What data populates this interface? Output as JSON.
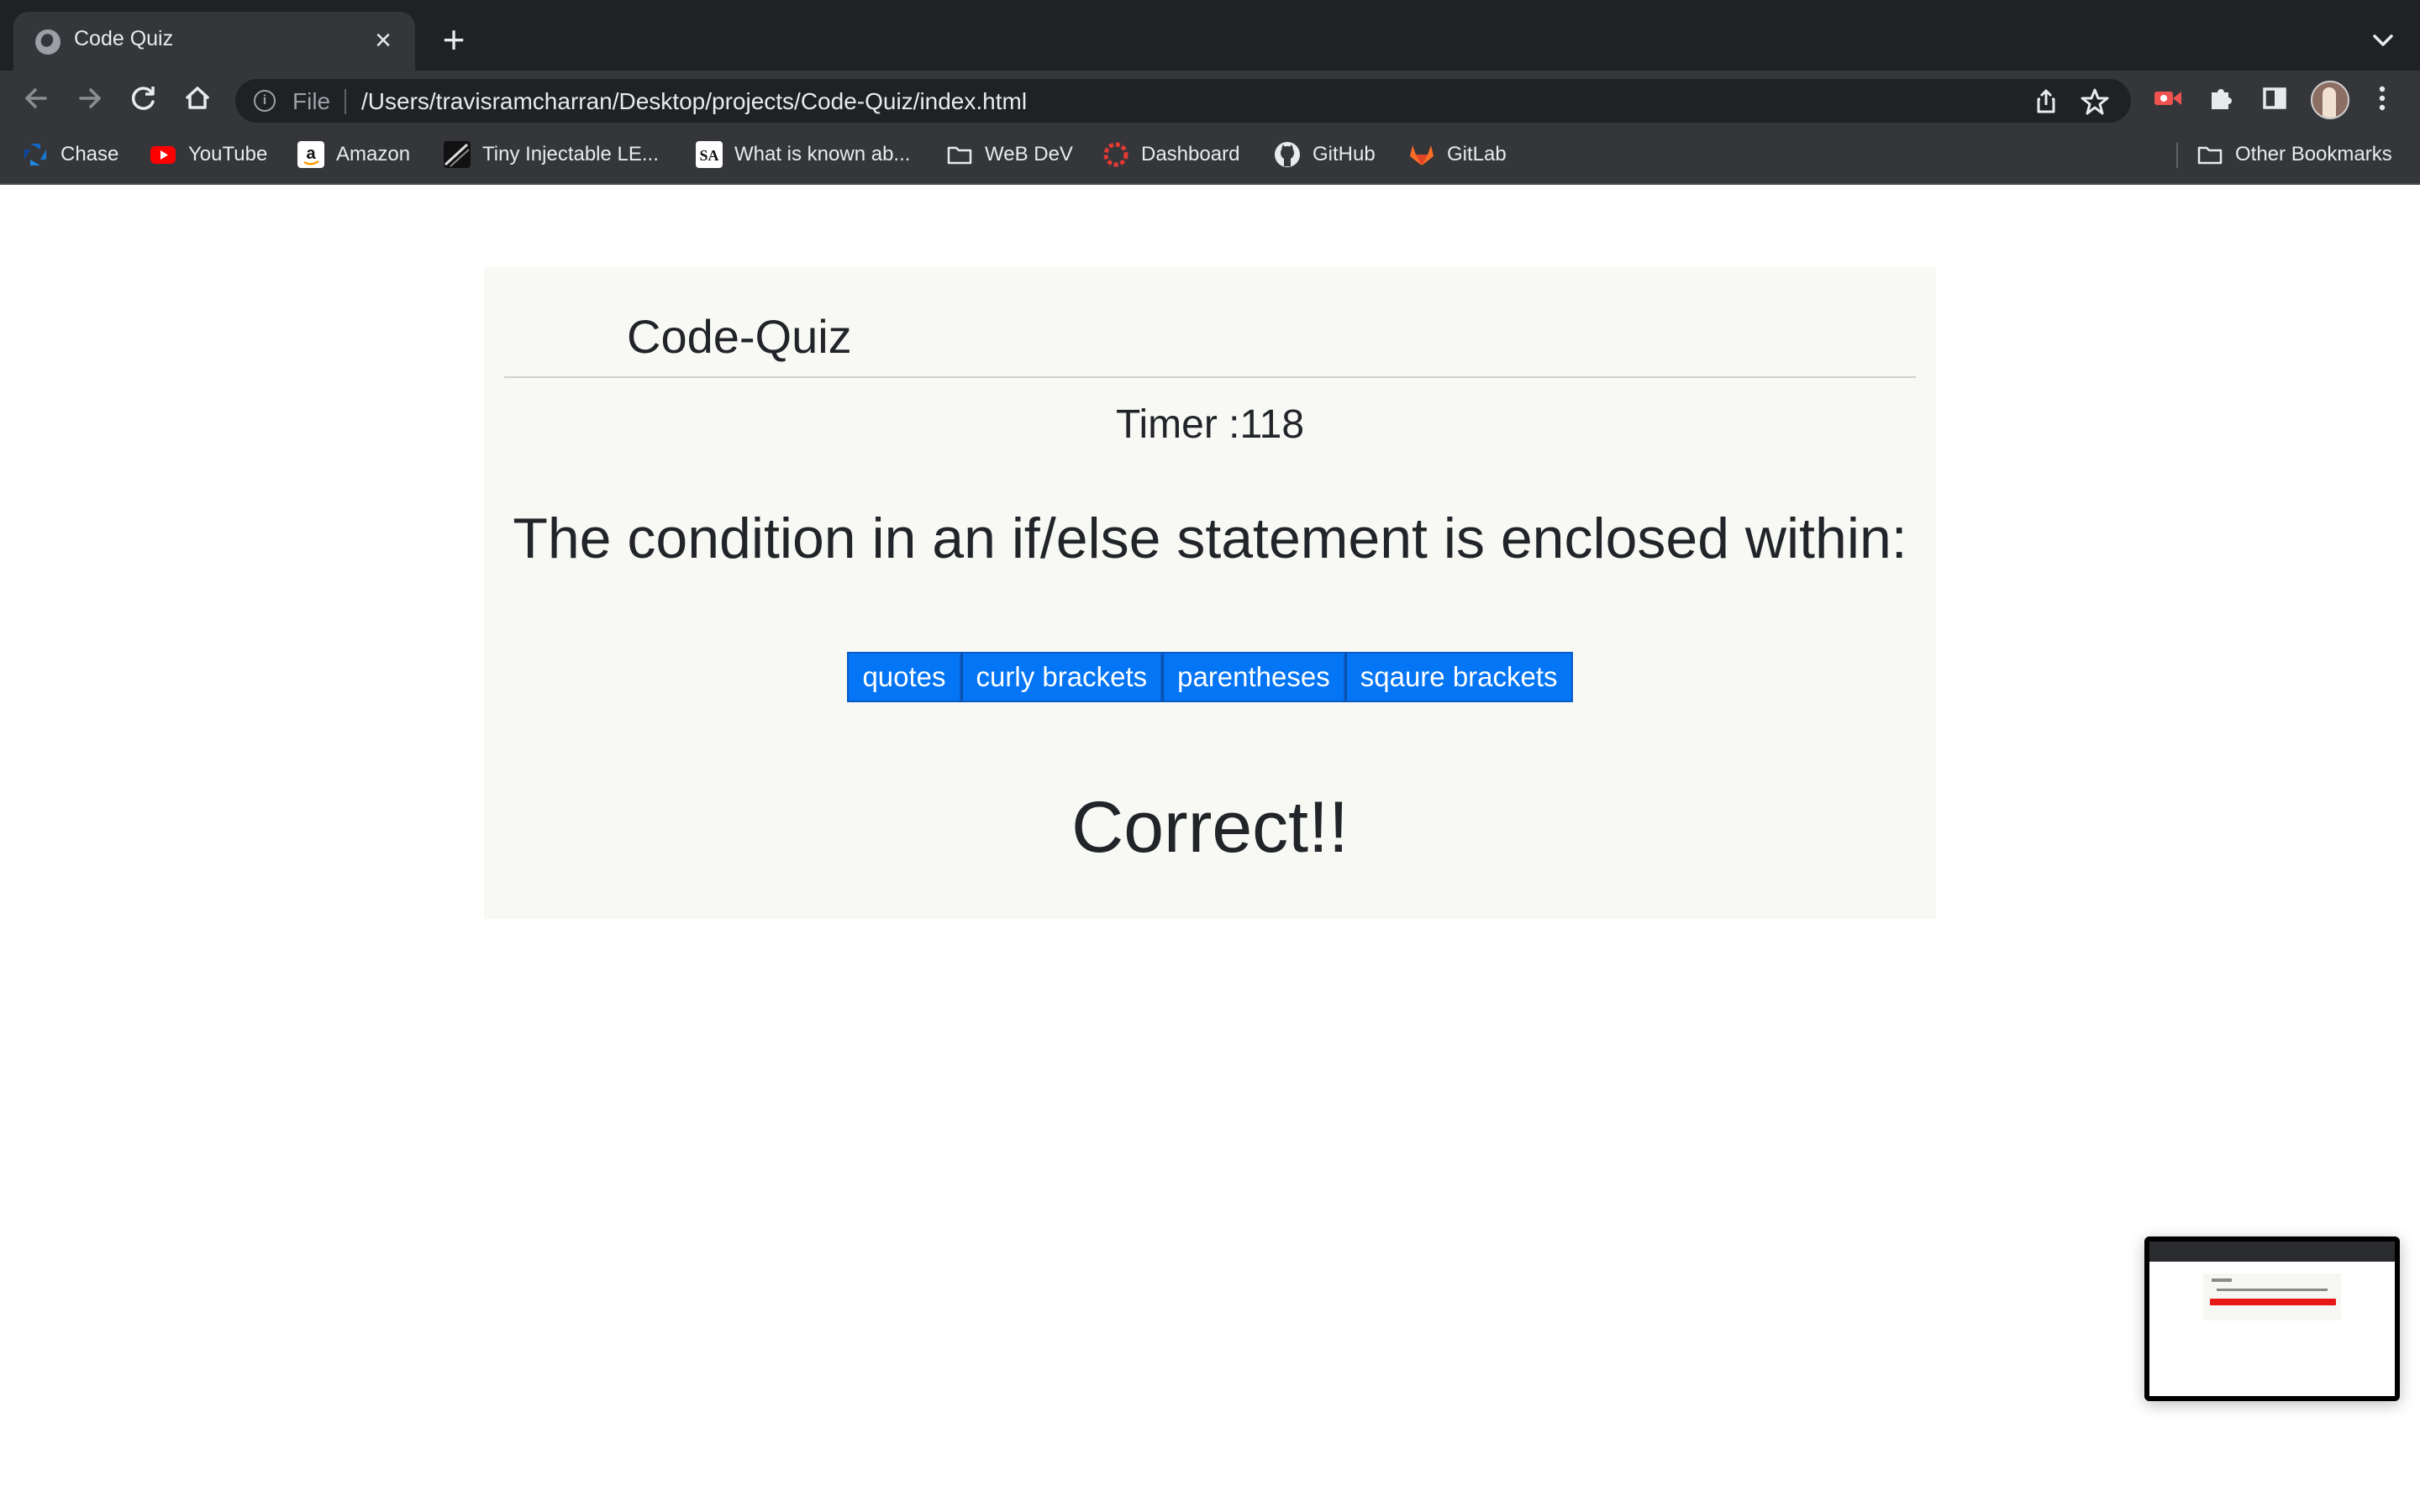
{
  "browser": {
    "tab": {
      "title": "Code Quiz"
    },
    "omnibox": {
      "scheme_label": "File",
      "url": "/Users/travisramcharran/Desktop/projects/Code-Quiz/index.html"
    },
    "bookmarks": [
      {
        "label": "Chase",
        "icon": "chase-icon"
      },
      {
        "label": "YouTube",
        "icon": "youtube-icon"
      },
      {
        "label": "Amazon",
        "icon": "amazon-icon"
      },
      {
        "label": "Tiny Injectable LE...",
        "icon": "site-icon"
      },
      {
        "label": "What is known ab...",
        "icon": "sa-icon"
      },
      {
        "label": "WeB DeV",
        "icon": "folder-icon"
      },
      {
        "label": "Dashboard",
        "icon": "dashboard-icon"
      },
      {
        "label": "GitHub",
        "icon": "github-icon"
      },
      {
        "label": "GitLab",
        "icon": "gitlab-icon"
      }
    ],
    "other_bookmarks": "Other Bookmarks"
  },
  "page": {
    "title": "Code-Quiz",
    "timer": "Timer :118",
    "question": "The condition in an if/else statement is enclosed within:",
    "answers": [
      "quotes",
      "curly brackets",
      "parentheses",
      "sqaure brackets"
    ],
    "feedback": "Correct!!",
    "accent_color": "#0375f5"
  }
}
